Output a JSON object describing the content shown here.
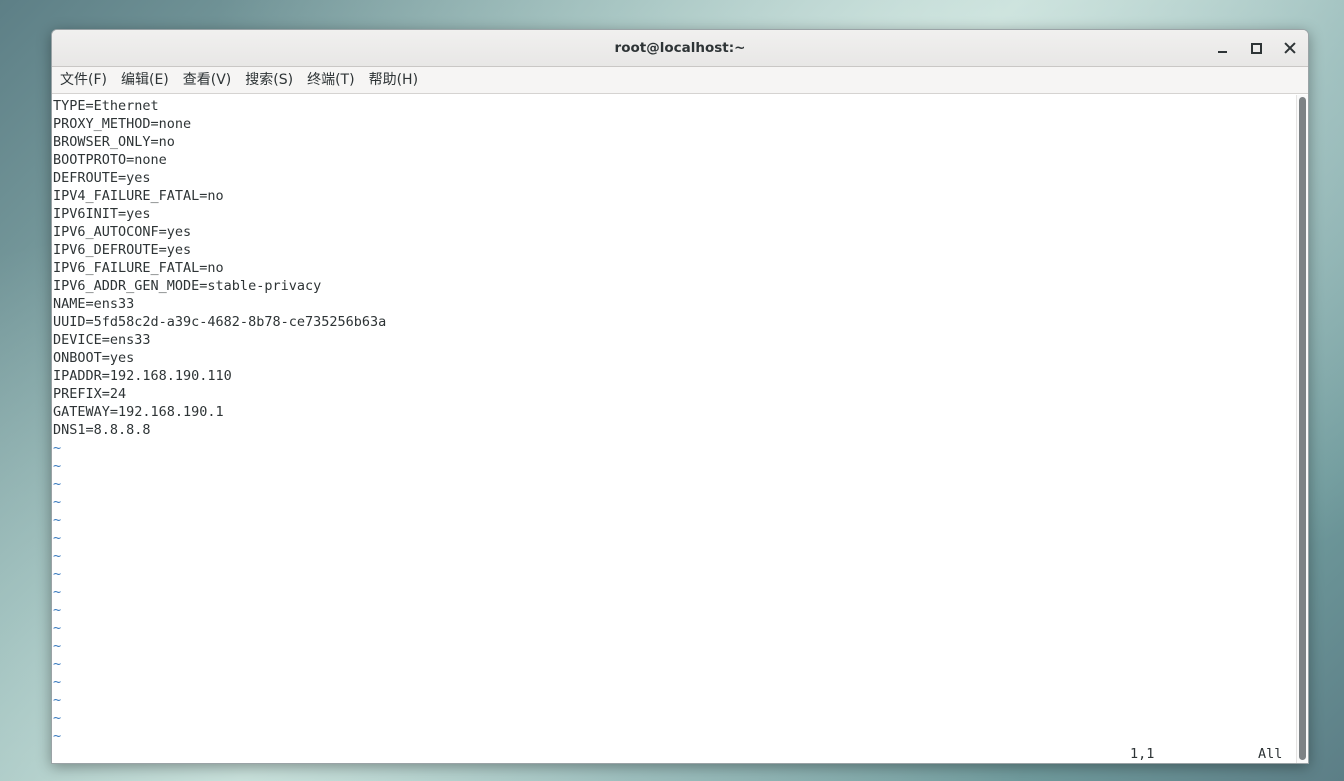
{
  "window": {
    "title": "root@localhost:~"
  },
  "menu": {
    "items": [
      "文件(F)",
      "编辑(E)",
      "查看(V)",
      "搜索(S)",
      "终端(T)",
      "帮助(H)"
    ]
  },
  "editor": {
    "lines": [
      "TYPE=Ethernet",
      "PROXY_METHOD=none",
      "BROWSER_ONLY=no",
      "BOOTPROTO=none",
      "DEFROUTE=yes",
      "IPV4_FAILURE_FATAL=no",
      "IPV6INIT=yes",
      "IPV6_AUTOCONF=yes",
      "IPV6_DEFROUTE=yes",
      "IPV6_FAILURE_FATAL=no",
      "IPV6_ADDR_GEN_MODE=stable-privacy",
      "NAME=ens33",
      "UUID=5fd58c2d-a39c-4682-8b78-ce735256b63a",
      "DEVICE=ens33",
      "ONBOOT=yes",
      "IPADDR=192.168.190.110",
      "PREFIX=24",
      "GATEWAY=192.168.190.1",
      "DNS1=8.8.8.8"
    ],
    "empty_marker": "~",
    "empty_line_count": 17,
    "empty_marker_color": "#3a7bbf"
  },
  "status": {
    "cursor_position": "1,1",
    "scroll_indicator": "All"
  },
  "icons": {
    "minimize": "minimize-icon",
    "maximize": "maximize-icon",
    "close": "close-icon"
  }
}
